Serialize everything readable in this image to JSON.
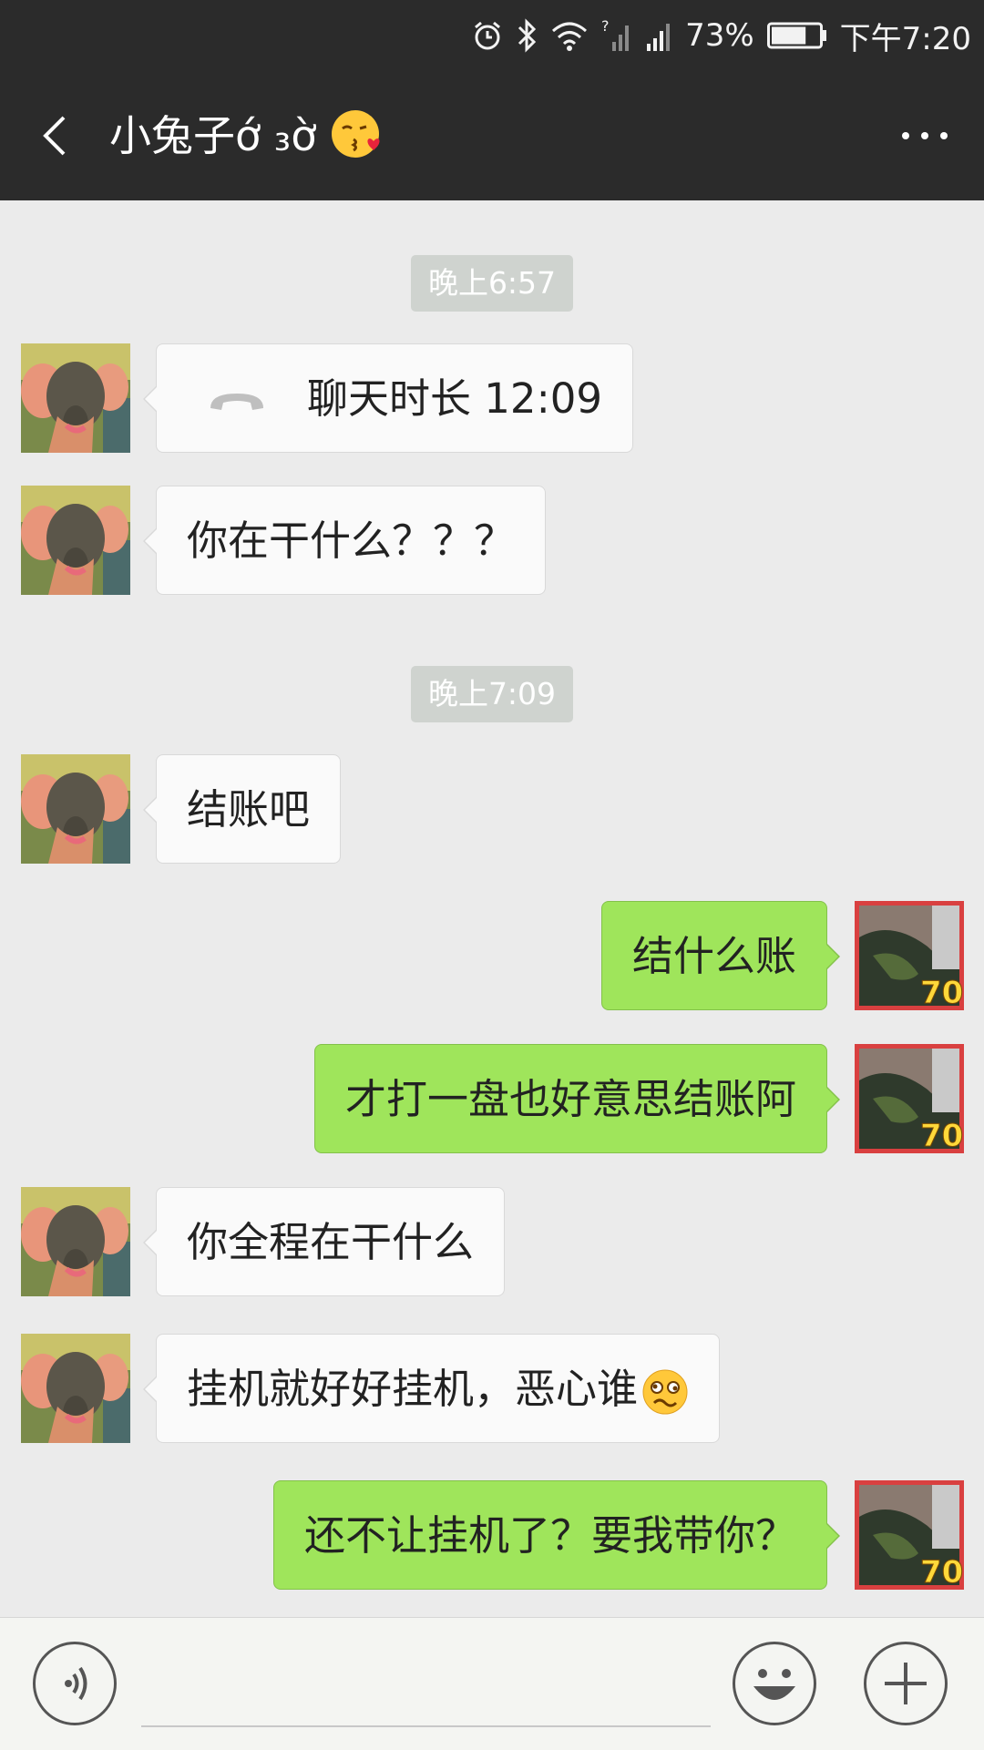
{
  "status_bar": {
    "battery_percent": "73%",
    "battery_level": 0.73,
    "time": "下午7:20",
    "icons": [
      "alarm-icon",
      "bluetooth-icon",
      "wifi-icon",
      "signal-unknown-icon",
      "signal-icon",
      "battery-icon"
    ]
  },
  "header": {
    "title": "小兔子ớ ₃ờ",
    "title_emoji": "kissing-face-heart-emoji",
    "back_icon": "chevron-left-icon",
    "more_icon": "more-dots-icon"
  },
  "messages": [
    {
      "type": "time",
      "text": "晚上6:57"
    },
    {
      "type": "call",
      "side": "left",
      "text": "聊天时长 12:09",
      "icon": "phone-hangup-icon"
    },
    {
      "type": "text",
      "side": "left",
      "text": "你在干什么？？？"
    },
    {
      "type": "time",
      "text": "晚上7:09"
    },
    {
      "type": "text",
      "side": "left",
      "text": "结账吧"
    },
    {
      "type": "text",
      "side": "right",
      "text": "结什么账"
    },
    {
      "type": "text",
      "side": "right",
      "text": "才打一盘也好意思结账阿"
    },
    {
      "type": "text",
      "side": "left",
      "text": "你全程在干什么"
    },
    {
      "type": "text",
      "side": "left",
      "text": "挂机就好好挂机，恶心谁",
      "emoji": "woozy-face-emoji"
    },
    {
      "type": "text",
      "side": "right",
      "text": "还不让挂机了？要我带你？"
    }
  ],
  "avatars": {
    "contact": "plush-elephant-avatar",
    "self": "game-avatar",
    "self_badge": "70"
  },
  "input_bar": {
    "voice_icon": "voice-icon",
    "emoji_icon": "smiley-icon",
    "plus_icon": "plus-icon",
    "input_value": ""
  },
  "colors": {
    "bar_bg": "#2b2b2b",
    "chat_bg": "#ebebeb",
    "incoming_bubble": "#fafafa",
    "outgoing_bubble": "#9fe55b",
    "time_pill": "#cfd3cf"
  }
}
